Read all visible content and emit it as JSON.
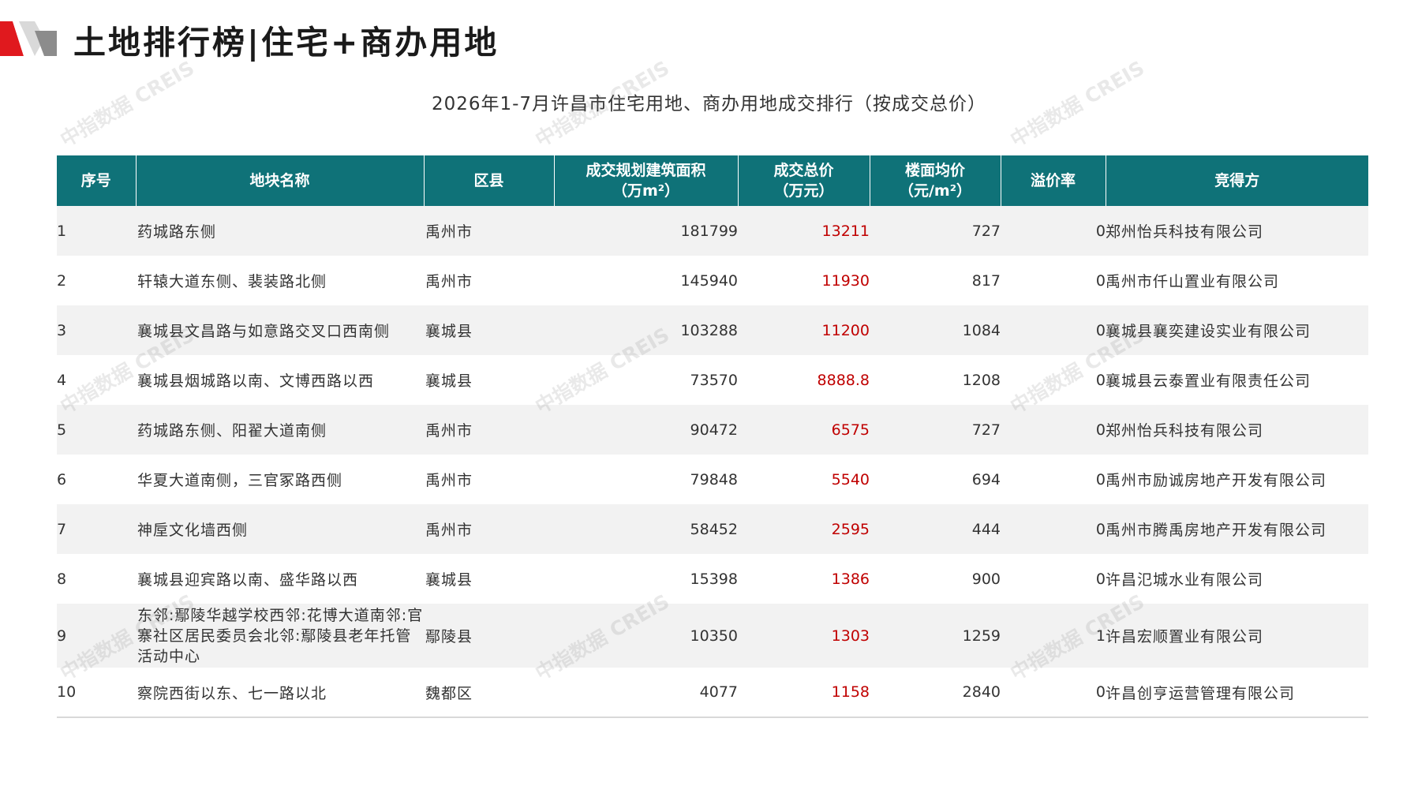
{
  "page": {
    "title": "土地排行榜|住宅+商办用地",
    "subtitle": "2026年1-7月许昌市住宅用地、商办用地成交排行（按成交总价）",
    "watermark": "中指数据 CREIS",
    "colors": {
      "header_bg": "#0f7278",
      "header_text": "#ffffff",
      "price_text": "#c00000",
      "brand_red": "#e0191e",
      "stripe": "#f2f2f2"
    }
  },
  "table": {
    "headers": {
      "idx": "序号",
      "name": "地块名称",
      "district": "区县",
      "area_l1": "成交规划建筑面积",
      "area_l2": "（万m²）",
      "price_l1": "成交总价",
      "price_l2": "（万元）",
      "unit_l1": "楼面均价",
      "unit_l2": "（元/m²）",
      "premium": "溢价率",
      "winner": "竞得方"
    },
    "rows": [
      {
        "idx": "1",
        "name": "药城路东侧",
        "district": "禹州市",
        "area": "181799",
        "price": "13211",
        "unit": "727",
        "premium": "0",
        "winner": "郑州怡兵科技有限公司"
      },
      {
        "idx": "2",
        "name": "轩辕大道东侧、裴装路北侧",
        "district": "禹州市",
        "area": "145940",
        "price": "11930",
        "unit": "817",
        "premium": "0",
        "winner": "禹州市仟山置业有限公司"
      },
      {
        "idx": "3",
        "name": "襄城县文昌路与如意路交叉口西南侧",
        "district": "襄城县",
        "area": "103288",
        "price": "11200",
        "unit": "1084",
        "premium": "0",
        "winner": "襄城县襄奕建设实业有限公司"
      },
      {
        "idx": "4",
        "name": "襄城县烟城路以南、文博西路以西",
        "district": "襄城县",
        "area": "73570",
        "price": "8888.8",
        "unit": "1208",
        "premium": "0",
        "winner": "襄城县云泰置业有限责任公司"
      },
      {
        "idx": "5",
        "name": "药城路东侧、阳翟大道南侧",
        "district": "禹州市",
        "area": "90472",
        "price": "6575",
        "unit": "727",
        "premium": "0",
        "winner": "郑州怡兵科技有限公司"
      },
      {
        "idx": "6",
        "name": "华夏大道南侧，三官冢路西侧",
        "district": "禹州市",
        "area": "79848",
        "price": "5540",
        "unit": "694",
        "premium": "0",
        "winner": "禹州市励诚房地产开发有限公司"
      },
      {
        "idx": "7",
        "name": "神垕文化墙西侧",
        "district": "禹州市",
        "area": "58452",
        "price": "2595",
        "unit": "444",
        "premium": "0",
        "winner": "禹州市腾禹房地产开发有限公司"
      },
      {
        "idx": "8",
        "name": "襄城县迎宾路以南、盛华路以西",
        "district": "襄城县",
        "area": "15398",
        "price": "1386",
        "unit": "900",
        "premium": "0",
        "winner": "许昌氾城水业有限公司"
      },
      {
        "idx": "9",
        "name": "东邻:鄢陵华越学校西邻:花博大道南邻:官寨社区居民委员会北邻:鄢陵县老年托管活动中心",
        "district": "鄢陵县",
        "area": "10350",
        "price": "1303",
        "unit": "1259",
        "premium": "1",
        "winner": "许昌宏顺置业有限公司"
      },
      {
        "idx": "10",
        "name": "察院西街以东、七一路以北",
        "district": "魏都区",
        "area": "4077",
        "price": "1158",
        "unit": "2840",
        "premium": "0",
        "winner": "许昌创亨运营管理有限公司"
      }
    ]
  }
}
